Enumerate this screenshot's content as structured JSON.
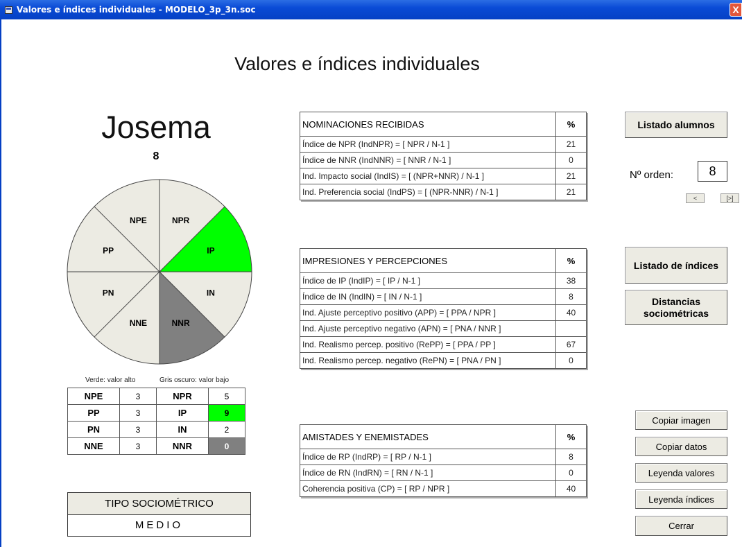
{
  "window": {
    "title": "Valores e índices individuales - MODELO_3p_3n.soc",
    "close_label": "X"
  },
  "page_title": "Valores e índices individuales",
  "student": {
    "name": "Josema",
    "number": "8"
  },
  "pie": {
    "segments": [
      {
        "label": "NPE",
        "color": "#ecebe3"
      },
      {
        "label": "NPR",
        "color": "#ecebe3"
      },
      {
        "label": "IP",
        "color": "#00ff00"
      },
      {
        "label": "IN",
        "color": "#ecebe3"
      },
      {
        "label": "NNR",
        "color": "#808080"
      },
      {
        "label": "NNE",
        "color": "#ecebe3"
      },
      {
        "label": "PN",
        "color": "#ecebe3"
      },
      {
        "label": "PP",
        "color": "#ecebe3"
      }
    ]
  },
  "legend": {
    "green": "Verde: valor alto",
    "gray": "Gris oscuro: valor bajo"
  },
  "values_grid": [
    {
      "k1": "NPE",
      "v1": "3",
      "k2": "NPR",
      "v2": "5"
    },
    {
      "k1": "PP",
      "v1": "3",
      "k2": "IP",
      "v2": "9"
    },
    {
      "k1": "PN",
      "v1": "3",
      "k2": "IN",
      "v2": "2"
    },
    {
      "k1": "NNE",
      "v1": "3",
      "k2": "NNR",
      "v2": "0"
    }
  ],
  "tipo": {
    "header": "TIPO SOCIOMÉTRICO",
    "value": "MEDIO"
  },
  "tables": {
    "nominaciones": {
      "header": "NOMINACIONES RECIBIDAS",
      "pct": "%",
      "rows": [
        {
          "desc": "Índice de NPR (IndNPR) = [ NPR / N-1 ]",
          "val": "21"
        },
        {
          "desc": "Índice de NNR (IndNNR) = [ NNR / N-1 ]",
          "val": "0"
        },
        {
          "desc": "Ind. Impacto social (IndIS) = [ (NPR+NNR) / N-1 ]",
          "val": "21"
        },
        {
          "desc": "Ind. Preferencia social (IndPS) = [ (NPR-NNR) / N-1 ]",
          "val": "21"
        }
      ]
    },
    "impresiones": {
      "header": "IMPRESIONES Y PERCEPCIONES",
      "pct": "%",
      "rows": [
        {
          "desc": "Índice de IP (IndIP) = [ IP / N-1 ]",
          "val": "38"
        },
        {
          "desc": "Índice de IN (IndIN) = [ IN / N-1 ]",
          "val": "8"
        },
        {
          "desc": "Ind. Ajuste perceptivo positivo (APP) = [ PPA / NPR ]",
          "val": "40"
        },
        {
          "desc": "Ind. Ajuste perceptivo negativo (APN) = [ PNA / NNR ]",
          "val": ""
        },
        {
          "desc": "Ind. Realismo percep. positivo (RePP) = [ PPA / PP ]",
          "val": "67"
        },
        {
          "desc": "Ind. Realismo percep. negativo (RePN) = [ PNA / PN ]",
          "val": "0"
        }
      ]
    },
    "amistades": {
      "header": "AMISTADES Y ENEMISTADES",
      "pct": "%",
      "rows": [
        {
          "desc": "Índice de RP (IndRP) = [ RP / N-1 ]",
          "val": "8"
        },
        {
          "desc": "Índice de RN (IndRN) = [ RN / N-1 ]",
          "val": "0"
        },
        {
          "desc": "Coherencia positiva (CP) = [ RP / NPR ]",
          "val": "40"
        }
      ]
    }
  },
  "buttons": {
    "listado_alumnos": "Listado alumnos",
    "orden_label": "Nº orden:",
    "orden_value": "8",
    "prev": "<",
    "next": "[>]",
    "listado_indices": "Listado de índices",
    "distancias_1": "Distancias",
    "distancias_2": "sociométricas",
    "copiar_imagen": "Copiar imagen",
    "copiar_datos": "Copiar datos",
    "leyenda_valores": "Leyenda valores",
    "leyenda_indices": "Leyenda índices",
    "cerrar": "Cerrar"
  }
}
